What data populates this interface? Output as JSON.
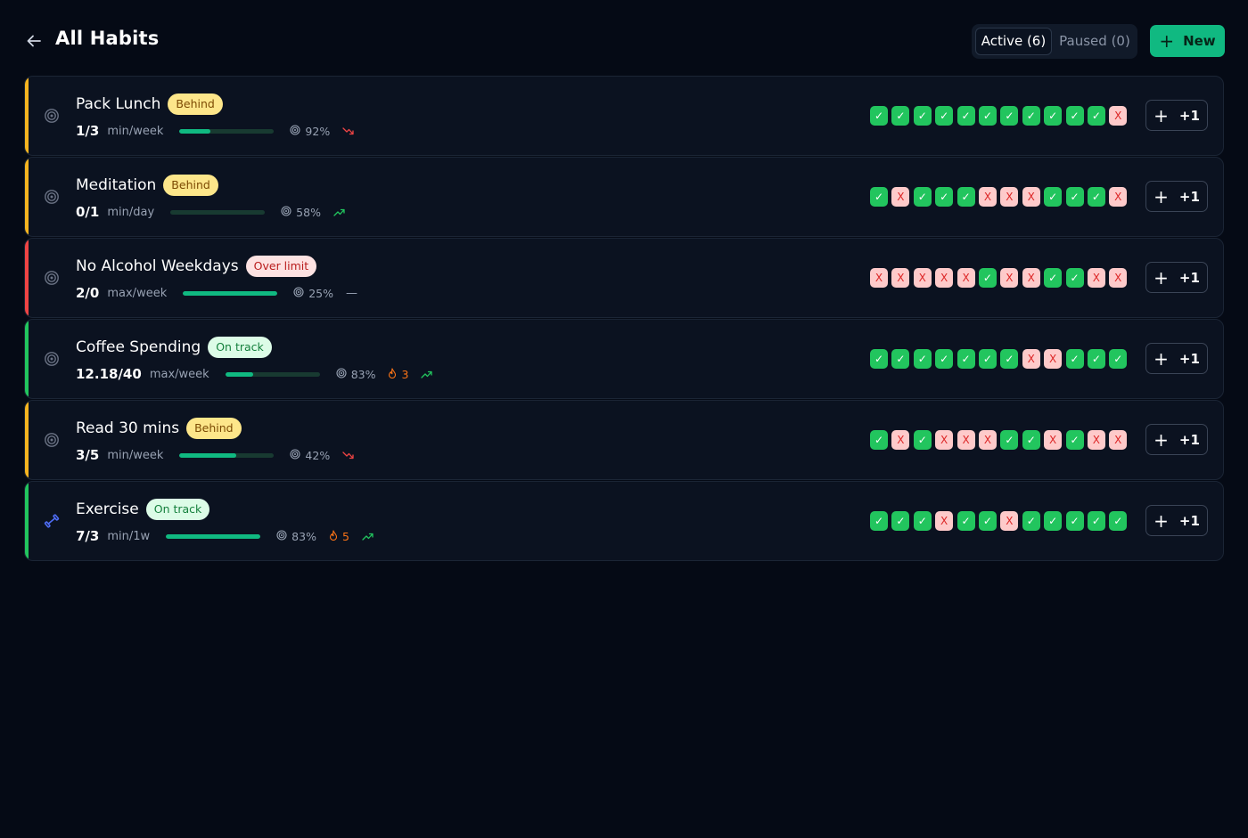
{
  "header": {
    "title": "All Habits",
    "tabs": [
      {
        "label": "Active (6)",
        "active": true
      },
      {
        "label": "Paused (0)",
        "active": false
      }
    ],
    "new_label": "New"
  },
  "colors": {
    "accent": "#10b981",
    "behind": "#f5b41f",
    "over_limit": "#ef4444",
    "on_track": "#22c55e"
  },
  "habits": [
    {
      "name": "Pack Lunch",
      "status": "Behind",
      "status_type": "behind",
      "count": "1/3",
      "unit": "min/week",
      "progress": 0.33,
      "percent": "92%",
      "streak": "",
      "trend": "down",
      "icon": "target-icon",
      "history": [
        "✓",
        "✓",
        "✓",
        "✓",
        "✓",
        "✓",
        "✓",
        "✓",
        "✓",
        "✓",
        "✓",
        "X"
      ],
      "inc_label": "+1"
    },
    {
      "name": "Meditation",
      "status": "Behind",
      "status_type": "behind",
      "count": "0/1",
      "unit": "min/day",
      "progress": 0,
      "percent": "58%",
      "streak": "",
      "trend": "up",
      "icon": "target-icon",
      "history": [
        "✓",
        "X",
        "✓",
        "✓",
        "✓",
        "X",
        "X",
        "X",
        "✓",
        "✓",
        "✓",
        "X"
      ],
      "inc_label": "+1"
    },
    {
      "name": "No Alcohol Weekdays",
      "status": "Over limit",
      "status_type": "over",
      "count": "2/0",
      "unit": "max/week",
      "progress": 1,
      "percent": "25%",
      "streak": "",
      "trend": "flat",
      "icon": "target-icon",
      "history": [
        "X",
        "X",
        "X",
        "X",
        "X",
        "✓",
        "X",
        "X",
        "✓",
        "✓",
        "X",
        "X"
      ],
      "inc_label": "+1"
    },
    {
      "name": "Coffee Spending",
      "status": "On track",
      "status_type": "ontrack",
      "count": "12.18/40",
      "unit": "max/week",
      "progress": 0.3,
      "percent": "83%",
      "streak": "3",
      "trend": "up",
      "icon": "target-icon",
      "history": [
        "✓",
        "✓",
        "✓",
        "✓",
        "✓",
        "✓",
        "✓",
        "X",
        "X",
        "✓",
        "✓",
        "✓"
      ],
      "inc_label": "+1"
    },
    {
      "name": "Read 30 mins",
      "status": "Behind",
      "status_type": "behind",
      "count": "3/5",
      "unit": "min/week",
      "progress": 0.6,
      "percent": "42%",
      "streak": "",
      "trend": "down",
      "icon": "target-icon",
      "history": [
        "✓",
        "X",
        "✓",
        "X",
        "X",
        "X",
        "✓",
        "✓",
        "X",
        "✓",
        "X",
        "X"
      ],
      "inc_label": "+1"
    },
    {
      "name": "Exercise",
      "status": "On track",
      "status_type": "ontrack",
      "count": "7/3",
      "unit": "min/1w",
      "progress": 1,
      "percent": "83%",
      "streak": "5",
      "trend": "up",
      "icon": "dumbbell-icon",
      "history": [
        "✓",
        "✓",
        "✓",
        "X",
        "✓",
        "✓",
        "X",
        "✓",
        "✓",
        "✓",
        "✓",
        "✓"
      ],
      "inc_label": "+1"
    }
  ]
}
